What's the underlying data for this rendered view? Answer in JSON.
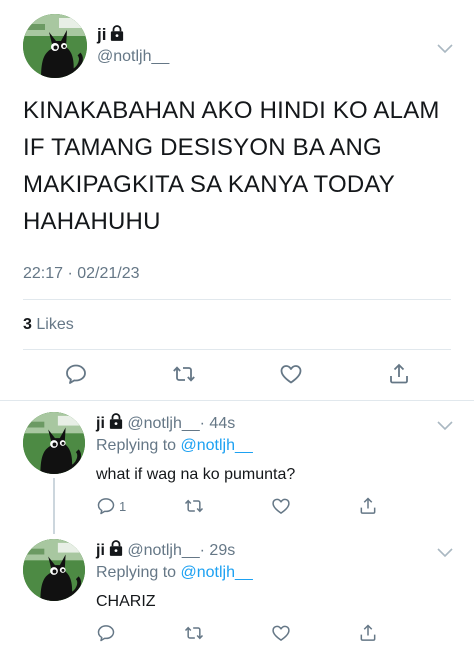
{
  "main_tweet": {
    "author": {
      "name": "ji",
      "handle": "@notljh__"
    },
    "text_lines": [
      "KINAKABAHAN AKO HINDI KO ALAM",
      "IF TAMANG DESISYON BA ANG",
      "MAKIPAGKITA SA KANYA TODAY",
      "HAHAHUHU"
    ],
    "timestamp": "22:17 · 02/21/23",
    "likes_count": "3",
    "likes_label": "Likes",
    "actions": [
      "reply-icon",
      "retweet-icon",
      "like-icon",
      "share-icon"
    ]
  },
  "replies": [
    {
      "name": "ji",
      "handle": "@notljh__",
      "time": "· 44s",
      "replying_prefix": "Replying to",
      "replying_to": "@notljh__",
      "text": "what if wag na ko pumunta?",
      "reply_count": "1"
    },
    {
      "name": "ji",
      "handle": "@notljh__",
      "time": "· 29s",
      "replying_prefix": "Replying to",
      "replying_to": "@notljh__",
      "text": "CHARIZ",
      "reply_count": ""
    }
  ],
  "colors": {
    "link": "#1da1f2",
    "secondary_text": "#657786",
    "divider": "#e1e8ed",
    "avatar_bg": "#4f8a45"
  }
}
